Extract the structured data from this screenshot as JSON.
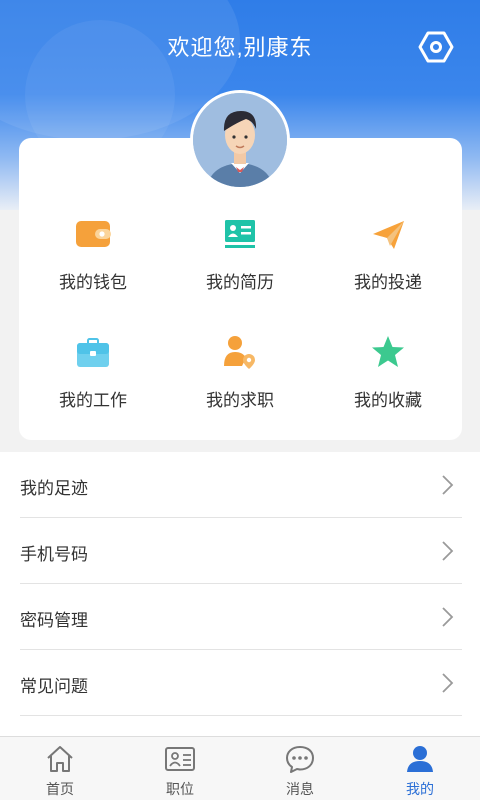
{
  "header": {
    "title": "欢迎您,别康东",
    "settings_icon": "settings-hexagon-icon",
    "gradient_colors": [
      "#2f7de8",
      "#8fb9f2"
    ]
  },
  "profile": {
    "avatar_icon": "user-avatar-illustration"
  },
  "grid": {
    "items": [
      {
        "label": "我的钱包",
        "icon": "wallet-icon",
        "color": "#f5a13b"
      },
      {
        "label": "我的简历",
        "icon": "resume-card-icon",
        "color": "#1fc3a8"
      },
      {
        "label": "我的投递",
        "icon": "paper-plane-icon",
        "color": "#f7a23a"
      },
      {
        "label": "我的工作",
        "icon": "briefcase-icon",
        "color": "#4fc3e8"
      },
      {
        "label": "我的求职",
        "icon": "person-location-icon",
        "color": "#f5a13b"
      },
      {
        "label": "我的收藏",
        "icon": "star-icon",
        "color": "#3cc98f"
      }
    ]
  },
  "menu": {
    "items": [
      {
        "label": "我的足迹"
      },
      {
        "label": "手机号码"
      },
      {
        "label": "密码管理"
      },
      {
        "label": "常见问题"
      }
    ]
  },
  "tabbar": {
    "active_color": "#2b6fd6",
    "tabs": [
      {
        "label": "首页",
        "icon": "home-icon"
      },
      {
        "label": "职位",
        "icon": "id-card-icon"
      },
      {
        "label": "消息",
        "icon": "chat-bubble-icon"
      },
      {
        "label": "我的",
        "icon": "person-icon",
        "active": true
      }
    ]
  }
}
